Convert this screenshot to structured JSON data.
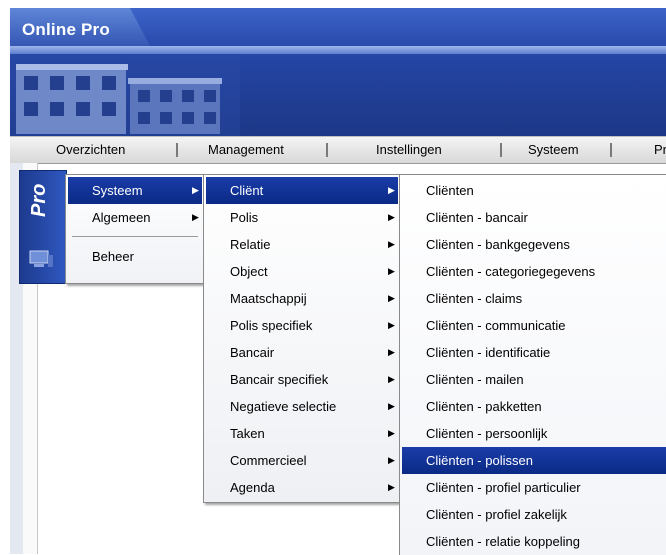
{
  "app": {
    "title": "Online Pro"
  },
  "menubar": {
    "items": [
      {
        "label": "Overzichten"
      },
      {
        "label": "Management"
      },
      {
        "label": "Instellingen"
      },
      {
        "label": "Systeem"
      },
      {
        "label": "Pr"
      }
    ]
  },
  "side_panel": {
    "logo_text": "Pro"
  },
  "menu1": {
    "items": [
      {
        "label": "Systeem"
      },
      {
        "label": "Algemeen"
      },
      {
        "label": "Beheer"
      }
    ],
    "selected": "Systeem"
  },
  "menu2": {
    "items": [
      {
        "label": "Cliënt"
      },
      {
        "label": "Polis"
      },
      {
        "label": "Relatie"
      },
      {
        "label": "Object"
      },
      {
        "label": "Maatschappij"
      },
      {
        "label": "Polis specifiek"
      },
      {
        "label": "Bancair"
      },
      {
        "label": "Bancair specifiek"
      },
      {
        "label": "Negatieve selectie"
      },
      {
        "label": "Taken"
      },
      {
        "label": "Commercieel"
      },
      {
        "label": "Agenda"
      }
    ],
    "selected": "Cliënt"
  },
  "menu3": {
    "items": [
      {
        "label": "Cliënten"
      },
      {
        "label": "Cliënten - bancair"
      },
      {
        "label": "Cliënten - bankgegevens"
      },
      {
        "label": "Cliënten - categoriegegevens"
      },
      {
        "label": "Cliënten - claims"
      },
      {
        "label": "Cliënten - communicatie"
      },
      {
        "label": "Cliënten - identificatie"
      },
      {
        "label": "Cliënten - mailen"
      },
      {
        "label": "Cliënten - pakketten"
      },
      {
        "label": "Cliënten - persoonlijk"
      },
      {
        "label": "Cliënten - polissen"
      },
      {
        "label": "Cliënten - profiel particulier"
      },
      {
        "label": "Cliënten - profiel zakelijk"
      },
      {
        "label": "Cliënten - relatie koppeling"
      }
    ],
    "selected": "Cliënten - polissen"
  },
  "colors": {
    "header_blue": "#2546a6",
    "highlight": "#0b2a86",
    "highlight_text": "#ffffff"
  }
}
